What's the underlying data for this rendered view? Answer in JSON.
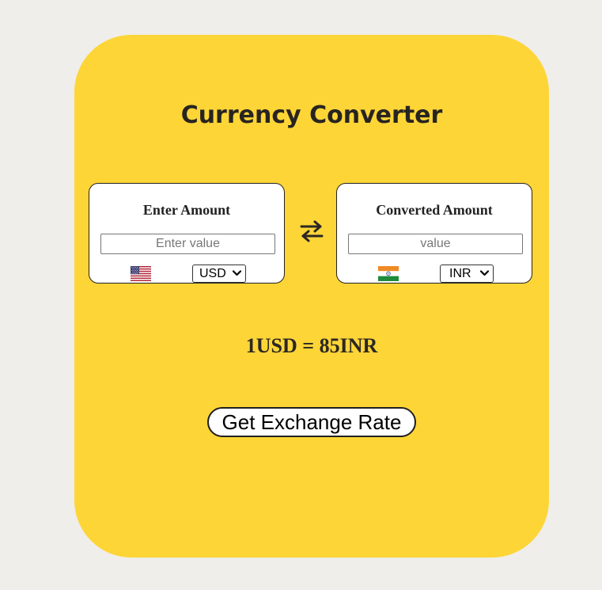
{
  "title": "Currency Converter",
  "from": {
    "label": "Enter Amount",
    "placeholder": "Enter value",
    "currency": "USD",
    "flag_icon": "us-flag-icon"
  },
  "to": {
    "label": "Converted Amount",
    "placeholder": "value",
    "currency": "INR",
    "flag_icon": "india-flag-icon"
  },
  "swap_icon": "swap-arrows-icon",
  "rate_text": "1USD = 85INR",
  "button_label": "Get Exchange Rate",
  "colors": {
    "background": "#efeeeb",
    "card": "#fed537",
    "text": "#272420"
  }
}
